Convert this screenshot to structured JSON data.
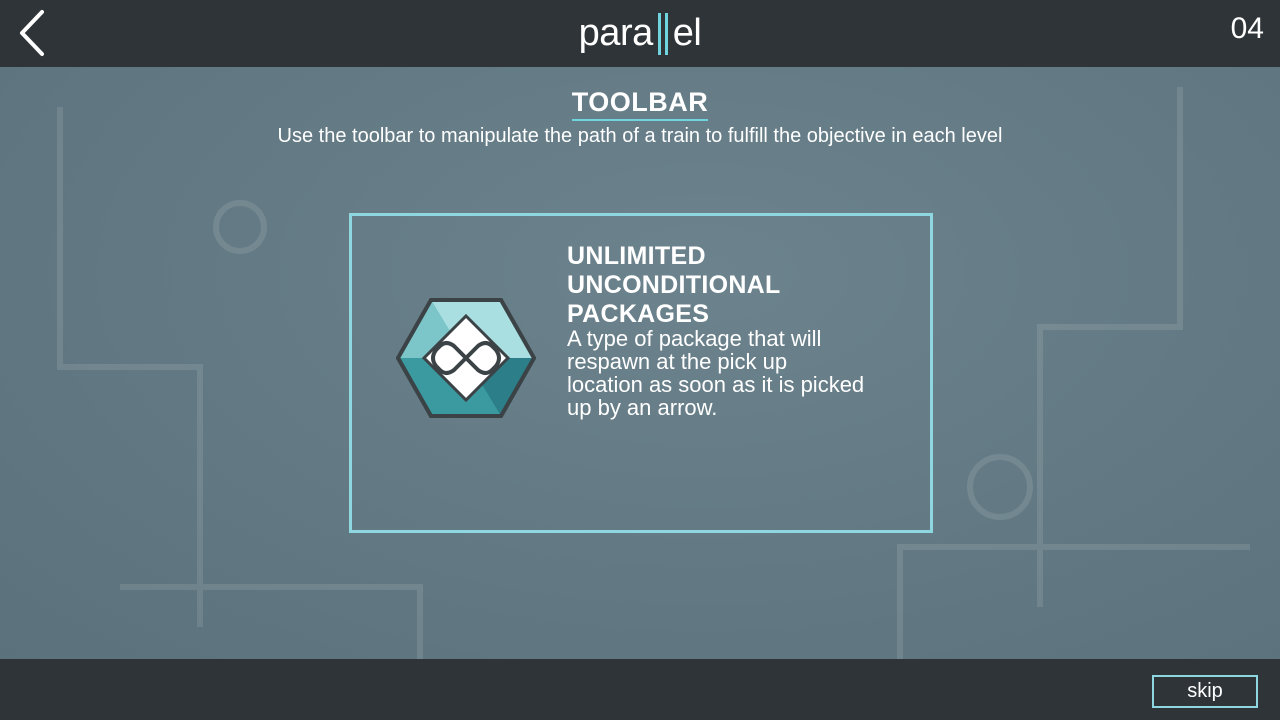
{
  "header": {
    "logo_left": "para",
    "logo_right": "el",
    "level_number": "04",
    "back_icon": "chevron-left-icon"
  },
  "section": {
    "title": "TOOLBAR",
    "subtitle": "Use the toolbar to manipulate the path of a train to fulfill the objective in each level"
  },
  "card": {
    "icon": "unlimited-package-icon",
    "title_lines": [
      "UNLIMITED",
      "UNCONDITIONAL",
      "PACKAGES"
    ],
    "description_lines": [
      "A type of package that will",
      "respawn at the pick up",
      "location as soon as it is picked",
      "up by an arrow."
    ]
  },
  "footer": {
    "skip_label": "skip"
  },
  "colors": {
    "bar_background": "#2e3438",
    "accent": "#6fd4de",
    "card_border": "#8fd7e0",
    "stage_background": "#647b85"
  }
}
